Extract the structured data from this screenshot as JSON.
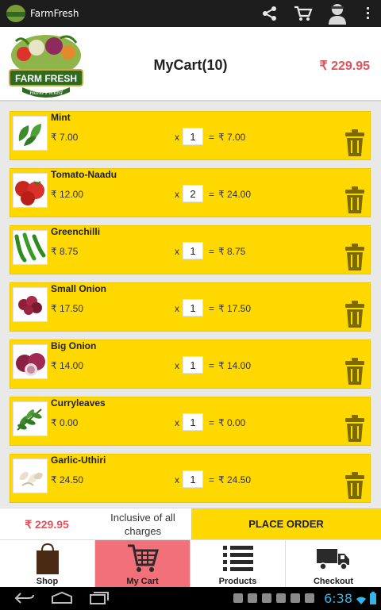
{
  "app": {
    "title": "FarmFresh"
  },
  "header": {
    "brand_line1": "FARM FRESH",
    "brand_line2": "Hand Picked",
    "cart_title": "MyCart(10)",
    "cart_total": "₹ 229.95"
  },
  "cart": {
    "items": [
      {
        "name": "Mint",
        "price": "₹ 7.00",
        "x": "x",
        "qty": "1",
        "eq": "=",
        "subtotal": "₹ 7.00",
        "icon": "mint-leaves"
      },
      {
        "name": "Tomato-Naadu",
        "price": "₹ 12.00",
        "x": "x",
        "qty": "2",
        "eq": "=",
        "subtotal": "₹ 24.00",
        "icon": "tomatoes"
      },
      {
        "name": "Greenchilli",
        "price": "₹ 8.75",
        "x": "x",
        "qty": "1",
        "eq": "=",
        "subtotal": "₹ 8.75",
        "icon": "green-chillies"
      },
      {
        "name": "Small Onion",
        "price": "₹ 17.50",
        "x": "x",
        "qty": "1",
        "eq": "=",
        "subtotal": "₹ 17.50",
        "icon": "small-onions"
      },
      {
        "name": "Big Onion",
        "price": "₹ 14.00",
        "x": "x",
        "qty": "1",
        "eq": "=",
        "subtotal": "₹ 14.00",
        "icon": "big-onions"
      },
      {
        "name": "Curryleaves",
        "price": "₹ 0.00",
        "x": "x",
        "qty": "1",
        "eq": "=",
        "subtotal": "₹ 0.00",
        "icon": "curry-leaves"
      },
      {
        "name": "Garlic-Uthiri",
        "price": "₹ 24.50",
        "x": "x",
        "qty": "1",
        "eq": "=",
        "subtotal": "₹ 24.50",
        "icon": "garlic"
      }
    ]
  },
  "summary": {
    "total": "₹ 229.95",
    "note": "Inclusive of all charges",
    "place_order_label": "PLACE ORDER"
  },
  "tabs": [
    {
      "label": "Shop",
      "icon": "shopping-bag"
    },
    {
      "label": "My Cart",
      "icon": "cart",
      "active": true
    },
    {
      "label": "Products",
      "icon": "list"
    },
    {
      "label": "Checkout",
      "icon": "delivery-truck"
    }
  ],
  "system": {
    "time": "6:38"
  },
  "colors": {
    "accent_yellow": "#ffd800",
    "price_red": "#e3515a",
    "active_tab": "#f2707a",
    "trash_olive": "#7a6a00"
  }
}
